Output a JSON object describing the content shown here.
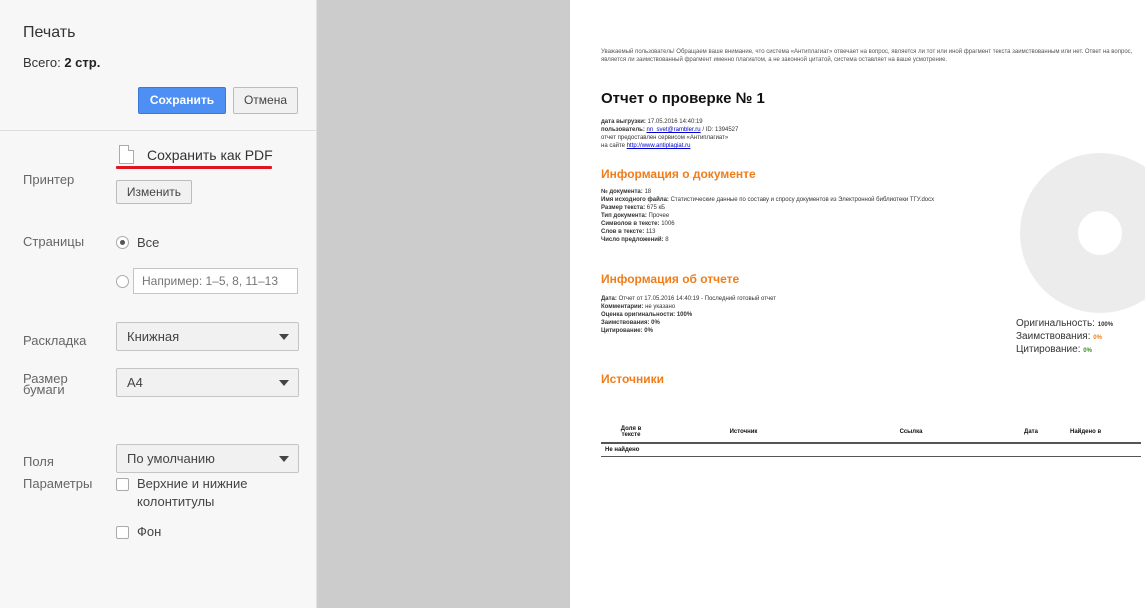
{
  "print_panel": {
    "title": "Печать",
    "total_label": "Всего:",
    "total_value": "2 стр.",
    "save_button": "Сохранить",
    "cancel_button": "Отмена",
    "printer_label": "Принтер",
    "destination": "Сохранить как PDF",
    "change_button": "Изменить",
    "pages_label": "Страницы",
    "pages_all": "Все",
    "pages_placeholder": "Например: 1–5, 8, 11–13",
    "layout_label": "Раскладка",
    "layout_value": "Книжная",
    "paper_label_1": "Размер",
    "paper_label_2": "бумаги",
    "paper_value": "A4",
    "margins_label": "Поля",
    "margins_value": "По умолчанию",
    "options_label": "Параметры",
    "headers_footers_1": "Верхние и нижние",
    "headers_footers_2": "колонтитулы",
    "background": "Фон"
  },
  "preview": {
    "notice": "Уважаемый пользователь! Обращаем ваше внимание, что система «Антиплагиат» отвечает на вопрос, является ли тот или иной фрагмент текста заимствованным или нет. Ответ на вопрос, является ли заимствованный фрагмент именно плагиатом, а не законной цитатой, система оставляет на ваше усмотрение.",
    "report_title": "Отчет о проверке № 1",
    "meta": {
      "export_date_label": "дата выгрузки:",
      "export_date": "17.05.2016 14:40:19",
      "user_label": "пользователь:",
      "user_email": "nn_svet@rambler.ru",
      "user_id": "/ ID: 1394527",
      "provided_by": "отчет предоставлен сервисом «Антиплагиат»",
      "site_prefix": "на сайте",
      "site_url": "http://www.antiplagiat.ru"
    },
    "doc_info": {
      "heading": "Информация о документе",
      "doc_num_label": "№ документа:",
      "doc_num": "18",
      "file_label": "Имя исходного файла:",
      "file_name": "Статистические данные по составу и спросу документов из Электронной библиотеки ТГУ.docx",
      "size_label": "Размер текста:",
      "size": "675 кБ",
      "type_label": "Тип документа:",
      "type": "Прочее",
      "chars_label": "Символов в тексте:",
      "chars": "1006",
      "words_label": "Слов в тексте:",
      "words": "113",
      "sentences_label": "Число предложений:",
      "sentences": "8"
    },
    "report_info": {
      "heading": "Информация об отчете",
      "date_label": "Дата:",
      "date": "Отчет от 17.05.2016 14:40:19 - Последний готовый отчет",
      "comments_label": "Комментарии:",
      "comments": "не указано",
      "originality_label": "Оценка оригинальности:",
      "originality": "100%",
      "borrowing_label": "Заимствования:",
      "borrowing": "0%",
      "citation_label": "Цитирование:",
      "citation": "0%"
    },
    "legend": {
      "originality_label": "Оригинальность:",
      "originality_value": "100%",
      "borrowing_label": "Заимствования:",
      "borrowing_value": "0%",
      "citation_label": "Цитирование:",
      "citation_value": "0%"
    },
    "sources": {
      "heading": "Источники",
      "col_share_1": "Доля в",
      "col_share_2": "тексте",
      "col_source": "Источник",
      "col_link": "Ссылка",
      "col_date": "Дата",
      "col_found": "Найдено в",
      "empty": "Не найдено"
    }
  }
}
